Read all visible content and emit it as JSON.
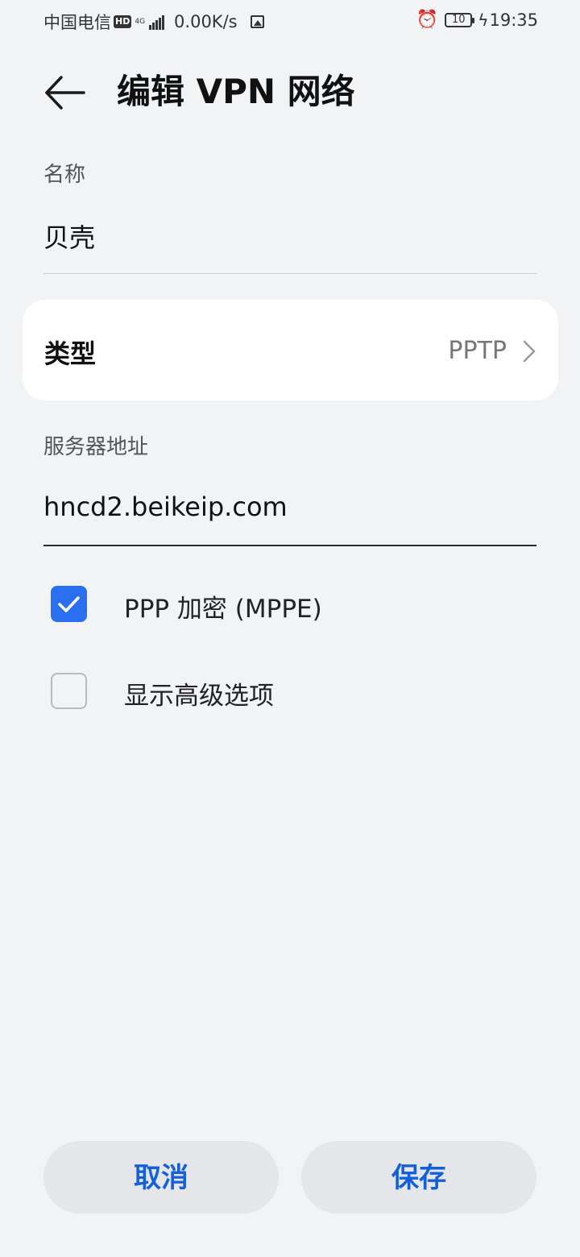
{
  "status_bar": {
    "carrier": "中国电信",
    "hd": "HD",
    "network": "4G",
    "speed": "0.00K/s",
    "battery": "10",
    "time": "19:35"
  },
  "header": {
    "title": "编辑 VPN 网络"
  },
  "form": {
    "name_label": "名称",
    "name_value": "贝壳",
    "type_label": "类型",
    "type_value": "PPTP",
    "server_label": "服务器地址",
    "server_value": "hncd2.beikeip.com",
    "ppp_label": "PPP 加密 (MPPE)",
    "ppp_checked": true,
    "advanced_label": "显示高级选项",
    "advanced_checked": false
  },
  "buttons": {
    "cancel": "取消",
    "save": "保存"
  },
  "colors": {
    "accent": "#2a6ff0",
    "button_text": "#1560d8",
    "background": "#f1f3f5"
  }
}
